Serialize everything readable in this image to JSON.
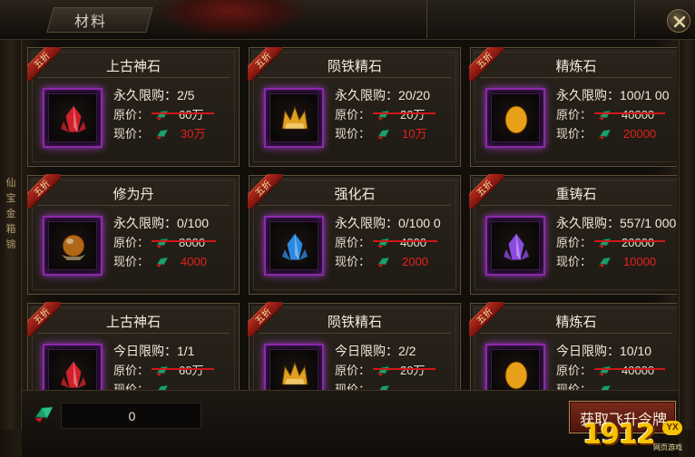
{
  "window": {
    "title": "材料"
  },
  "side_text": "仙 宝 金 箱 锦",
  "items": [
    {
      "name": "上古神石",
      "badge": "五折",
      "limit": "永久限购：2/5",
      "orig_label": "原价：",
      "orig": "60万",
      "now_label": "现价：",
      "now": "30万",
      "icon": "red-crystal-icon",
      "icon_color": "#d0202a"
    },
    {
      "name": "陨铁精石",
      "badge": "五折",
      "limit": "永久限购：20/20",
      "orig_label": "原价：",
      "orig": "20万",
      "now_label": "现价：",
      "now": "10万",
      "icon": "gold-crown-ore-icon",
      "icon_color": "#e0a020"
    },
    {
      "name": "精炼石",
      "badge": "五折",
      "limit": "永久限购：100/1 00",
      "orig_label": "原价：",
      "orig": "40000",
      "now_label": "现价：",
      "now": "20000",
      "icon": "gold-moon-stone-icon",
      "icon_color": "#e8a018"
    },
    {
      "name": "修为丹",
      "badge": "五折",
      "limit": "永久限购：0/100",
      "orig_label": "原价：",
      "orig": "8000",
      "now_label": "现价：",
      "now": "4000",
      "icon": "bronze-orb-icon",
      "icon_color": "#b06818"
    },
    {
      "name": "强化石",
      "badge": "五折",
      "limit": "永久限购：0/100 0",
      "orig_label": "原价：",
      "orig": "4000",
      "now_label": "现价：",
      "now": "2000",
      "icon": "blue-crystal-icon",
      "icon_color": "#2a8ae0"
    },
    {
      "name": "重铸石",
      "badge": "五折",
      "limit": "永久限购：557/1 000",
      "orig_label": "原价：",
      "orig": "20000",
      "now_label": "现价：",
      "now": "10000",
      "icon": "purple-crystal-icon",
      "icon_color": "#8a4ae0"
    },
    {
      "name": "上古神石",
      "badge": "五折",
      "limit": "今日限购：1/1",
      "orig_label": "原价：",
      "orig": "60万",
      "now_label": "现价：",
      "now": "",
      "icon": "red-crystal-icon",
      "icon_color": "#d0202a"
    },
    {
      "name": "陨铁精石",
      "badge": "五折",
      "limit": "今日限购：2/2",
      "orig_label": "原价：",
      "orig": "20万",
      "now_label": "现价：",
      "now": "",
      "icon": "gold-crown-ore-icon",
      "icon_color": "#e0a020"
    },
    {
      "name": "精炼石",
      "badge": "五折",
      "limit": "今日限购：10/10",
      "orig_label": "原价：",
      "orig": "40000",
      "now_label": "现价：",
      "now": "",
      "icon": "gold-moon-stone-icon",
      "icon_color": "#e8a018"
    }
  ],
  "footer": {
    "balance": "0",
    "action_label": "获取飞升令牌",
    "currency_icon": "jade-currency-icon"
  },
  "logo": {
    "text": "1912",
    "badge": "YX",
    "sub": "网页游戏"
  },
  "colors": {
    "accent_purple": "#8a2aa8",
    "price_red": "#e0231e",
    "strike_red": "#d01818"
  }
}
